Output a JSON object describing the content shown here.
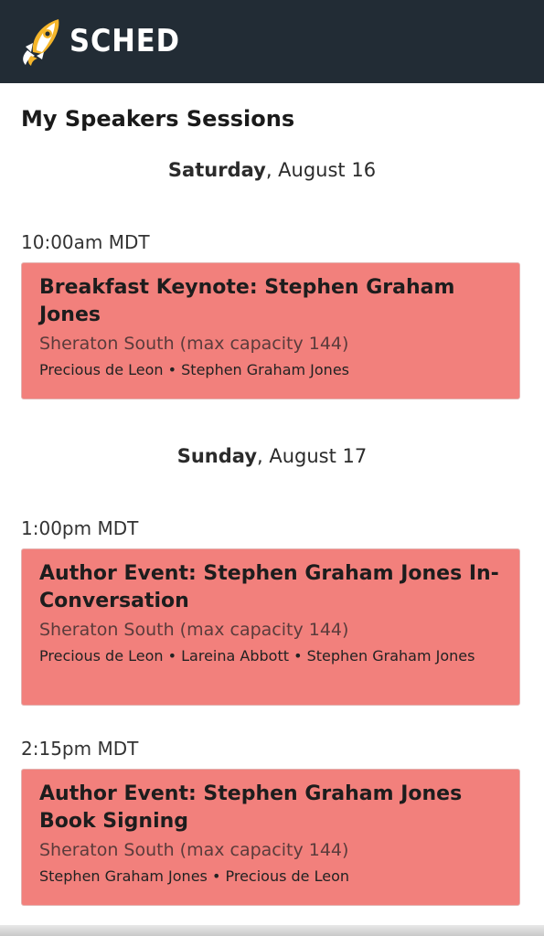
{
  "app": {
    "brand_name": "SCHED",
    "colors": {
      "header_bg": "#222c35",
      "card_bg": "#f2807c",
      "logo_accent": "#f5b62b"
    }
  },
  "page": {
    "title": "My Speakers Sessions"
  },
  "days": [
    {
      "weekday": "Saturday",
      "date": ", August 16",
      "slots": [
        {
          "time": "10:00am MDT",
          "sessions": [
            {
              "title": "Breakfast Keynote: Stephen Graham Jones",
              "venue": "Sheraton South (max capacity 144)",
              "speakers": "Precious de Leon • Stephen Graham Jones"
            }
          ]
        }
      ]
    },
    {
      "weekday": "Sunday",
      "date": ", August 17",
      "slots": [
        {
          "time": "1:00pm MDT",
          "sessions": [
            {
              "title": "Author Event: Stephen Graham Jones In-Conversation",
              "venue": "Sheraton South (max capacity 144)",
              "speakers": "Precious de Leon • Lareina Abbott • Stephen Graham Jones"
            }
          ]
        },
        {
          "time": "2:15pm MDT",
          "sessions": [
            {
              "title": "Author Event: Stephen Graham Jones Book Signing",
              "venue": "Sheraton South (max capacity 144)",
              "speakers": "Stephen Graham Jones • Precious de Leon"
            }
          ]
        }
      ]
    }
  ]
}
